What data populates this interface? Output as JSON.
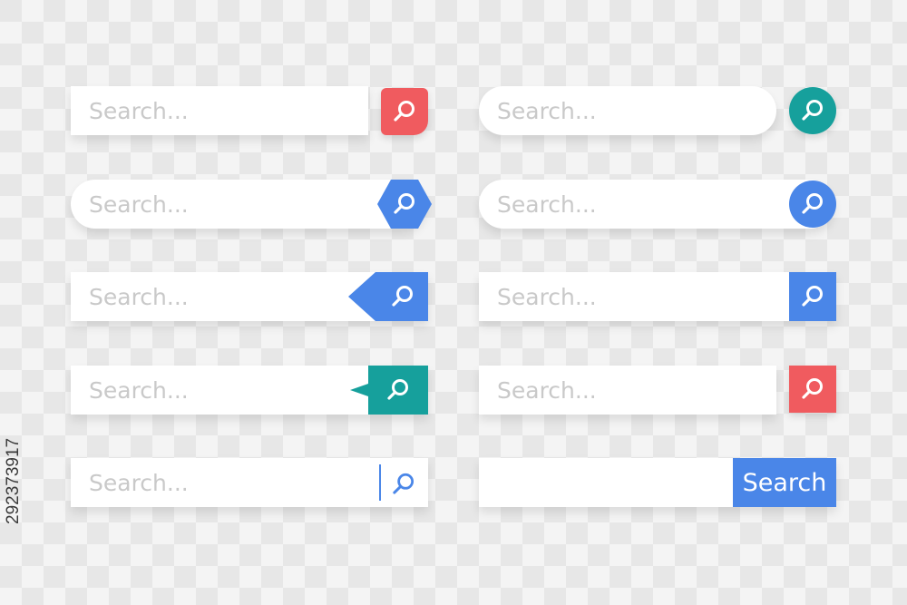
{
  "placeholder": "Search...",
  "button_label": "Search",
  "watermark": "292373917",
  "colors": {
    "red": "#f05b5f",
    "teal": "#16a09c",
    "blue": "#4a86e8",
    "field_text": "#c9c9c9",
    "white": "#ffffff"
  },
  "search_bars": [
    {
      "style": "square-field-red-rounded-square-button",
      "placeholder": "Search...",
      "icon": "magnifier-icon"
    },
    {
      "style": "pill-field-blue-hexagon-button",
      "placeholder": "Search...",
      "icon": "magnifier-icon"
    },
    {
      "style": "square-field-blue-arrow-tab-button",
      "placeholder": "Search...",
      "icon": "magnifier-icon"
    },
    {
      "style": "square-field-teal-speech-tab-button",
      "placeholder": "Search...",
      "icon": "magnifier-icon"
    },
    {
      "style": "square-field-inline-divider-icon",
      "placeholder": "Search...",
      "icon": "magnifier-icon"
    },
    {
      "style": "pill-field-teal-circle-button",
      "placeholder": "Search...",
      "icon": "magnifier-icon"
    },
    {
      "style": "pill-field-blue-circle-button-overlap",
      "placeholder": "Search...",
      "icon": "magnifier-icon"
    },
    {
      "style": "square-field-blue-square-button-attached",
      "placeholder": "Search...",
      "icon": "magnifier-icon"
    },
    {
      "style": "square-field-red-square-button",
      "placeholder": "Search...",
      "icon": "magnifier-icon"
    },
    {
      "style": "square-field-blue-text-button",
      "placeholder": "",
      "button_label": "Search"
    }
  ]
}
